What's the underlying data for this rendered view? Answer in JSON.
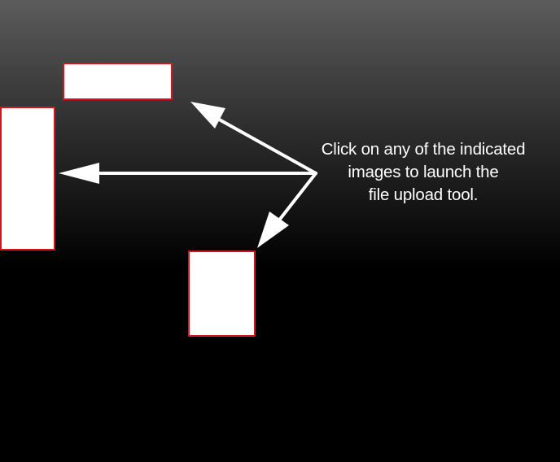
{
  "instructions": {
    "lines": [
      "Click on any of the indicated",
      "images to launch the",
      "file upload tool."
    ]
  },
  "upload_slots": [
    {
      "name": "image-slot-top"
    },
    {
      "name": "image-slot-left"
    },
    {
      "name": "image-slot-bottom"
    }
  ],
  "colors": {
    "background_top": "#5c5c5c",
    "background_bottom": "#000000",
    "slot_fill": "#ffffff",
    "slot_border": "#d7141e",
    "text": "#ffffff",
    "arrow": "#ffffff"
  },
  "icons": [
    "arrow-to-top-slot-icon",
    "arrow-to-left-slot-icon",
    "arrow-to-bottom-slot-icon"
  ]
}
